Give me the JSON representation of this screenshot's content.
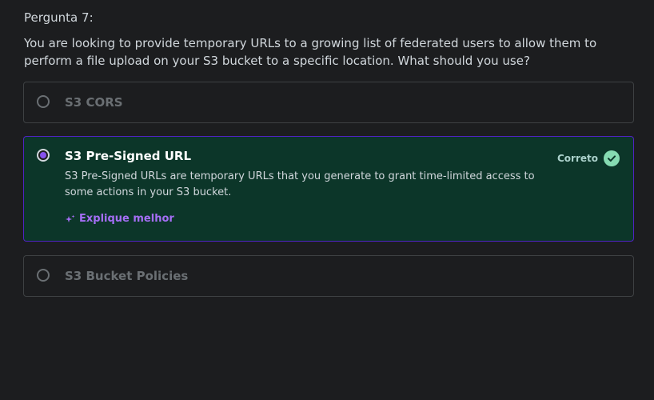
{
  "question": {
    "number_label": "Pergunta 7:",
    "text": "You are looking to provide temporary URLs to a growing list of federated users to allow them to perform a file upload on your S3 bucket to a specific location. What should you use?"
  },
  "options": [
    {
      "label": "S3 CORS",
      "selected": false
    },
    {
      "label": "S3 Pre-Signed URL",
      "selected": true,
      "explanation": "S3 Pre-Signed URLs are temporary URLs that you generate to grant time-limited access to some actions in your S3 bucket.",
      "explain_link": "Explique melhor",
      "explain_link_icon": "sparkle-icon",
      "status_label": "Correto",
      "status_icon": "check-circle-icon"
    },
    {
      "label": "S3 Bucket Policies",
      "selected": false
    }
  ],
  "colors": {
    "background": "#1c1d1f",
    "correct_background": "#0c3629",
    "selected_border": "#5022c3",
    "accent_purple": "#a56ef5",
    "correct_green": "#86dbb2"
  }
}
